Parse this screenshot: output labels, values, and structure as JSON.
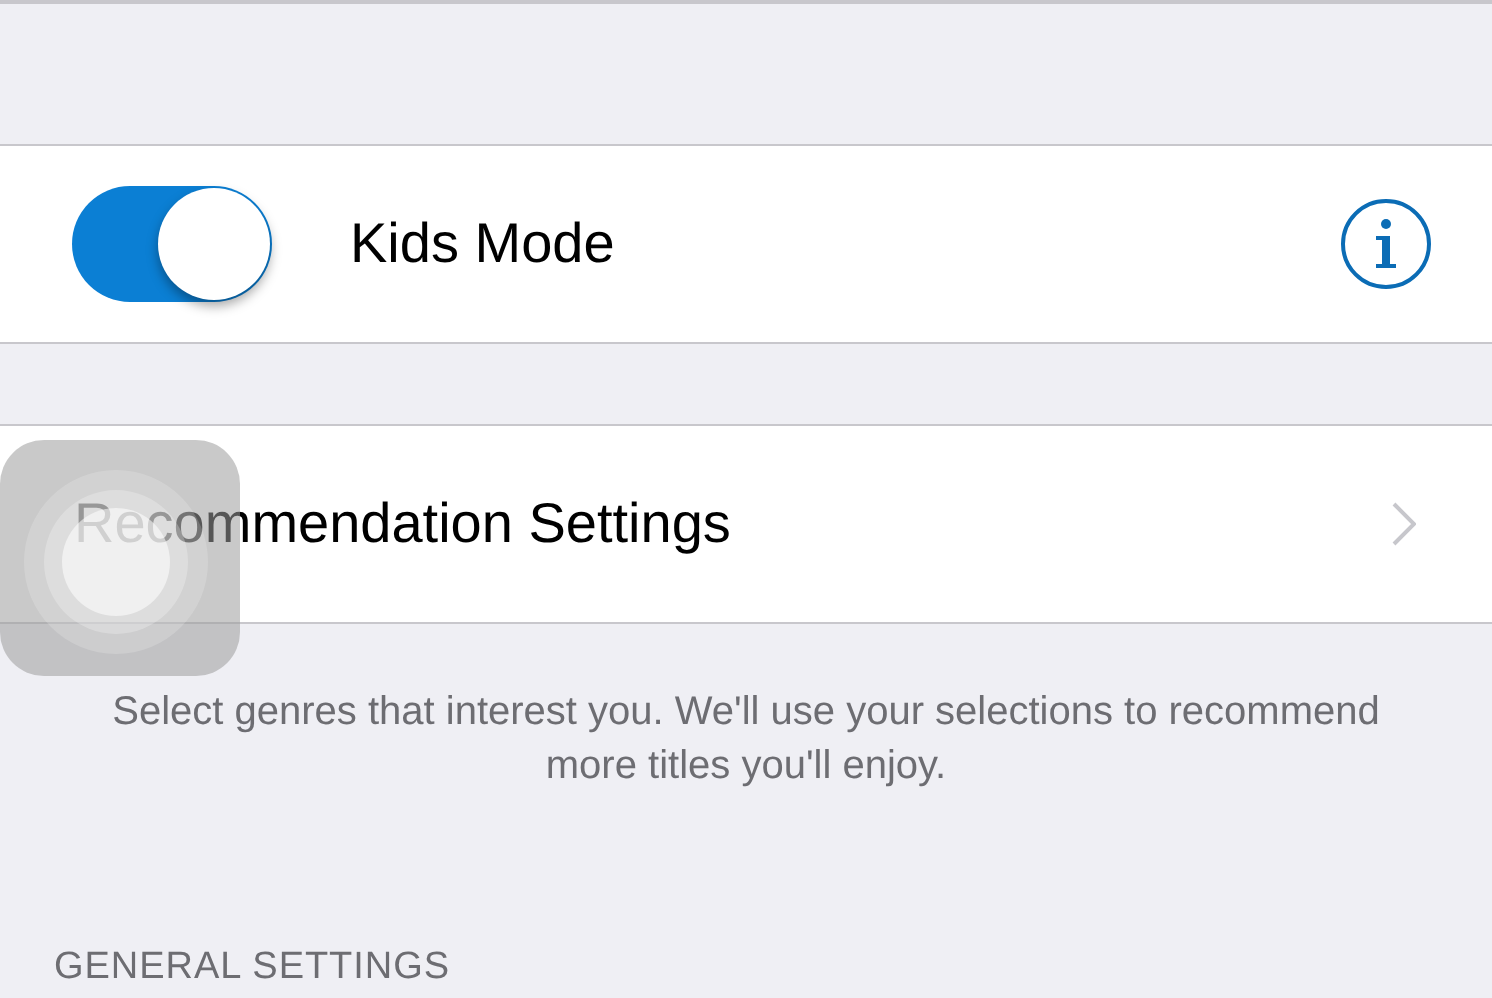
{
  "kids_mode": {
    "label": "Kids Mode",
    "on": true
  },
  "recommendation_settings": {
    "label": "Recommendation Settings"
  },
  "footer": "Select genres that interest you. We'll use your selections to recommend more titles you'll enjoy.",
  "section_header": "GENERAL SETTINGS"
}
